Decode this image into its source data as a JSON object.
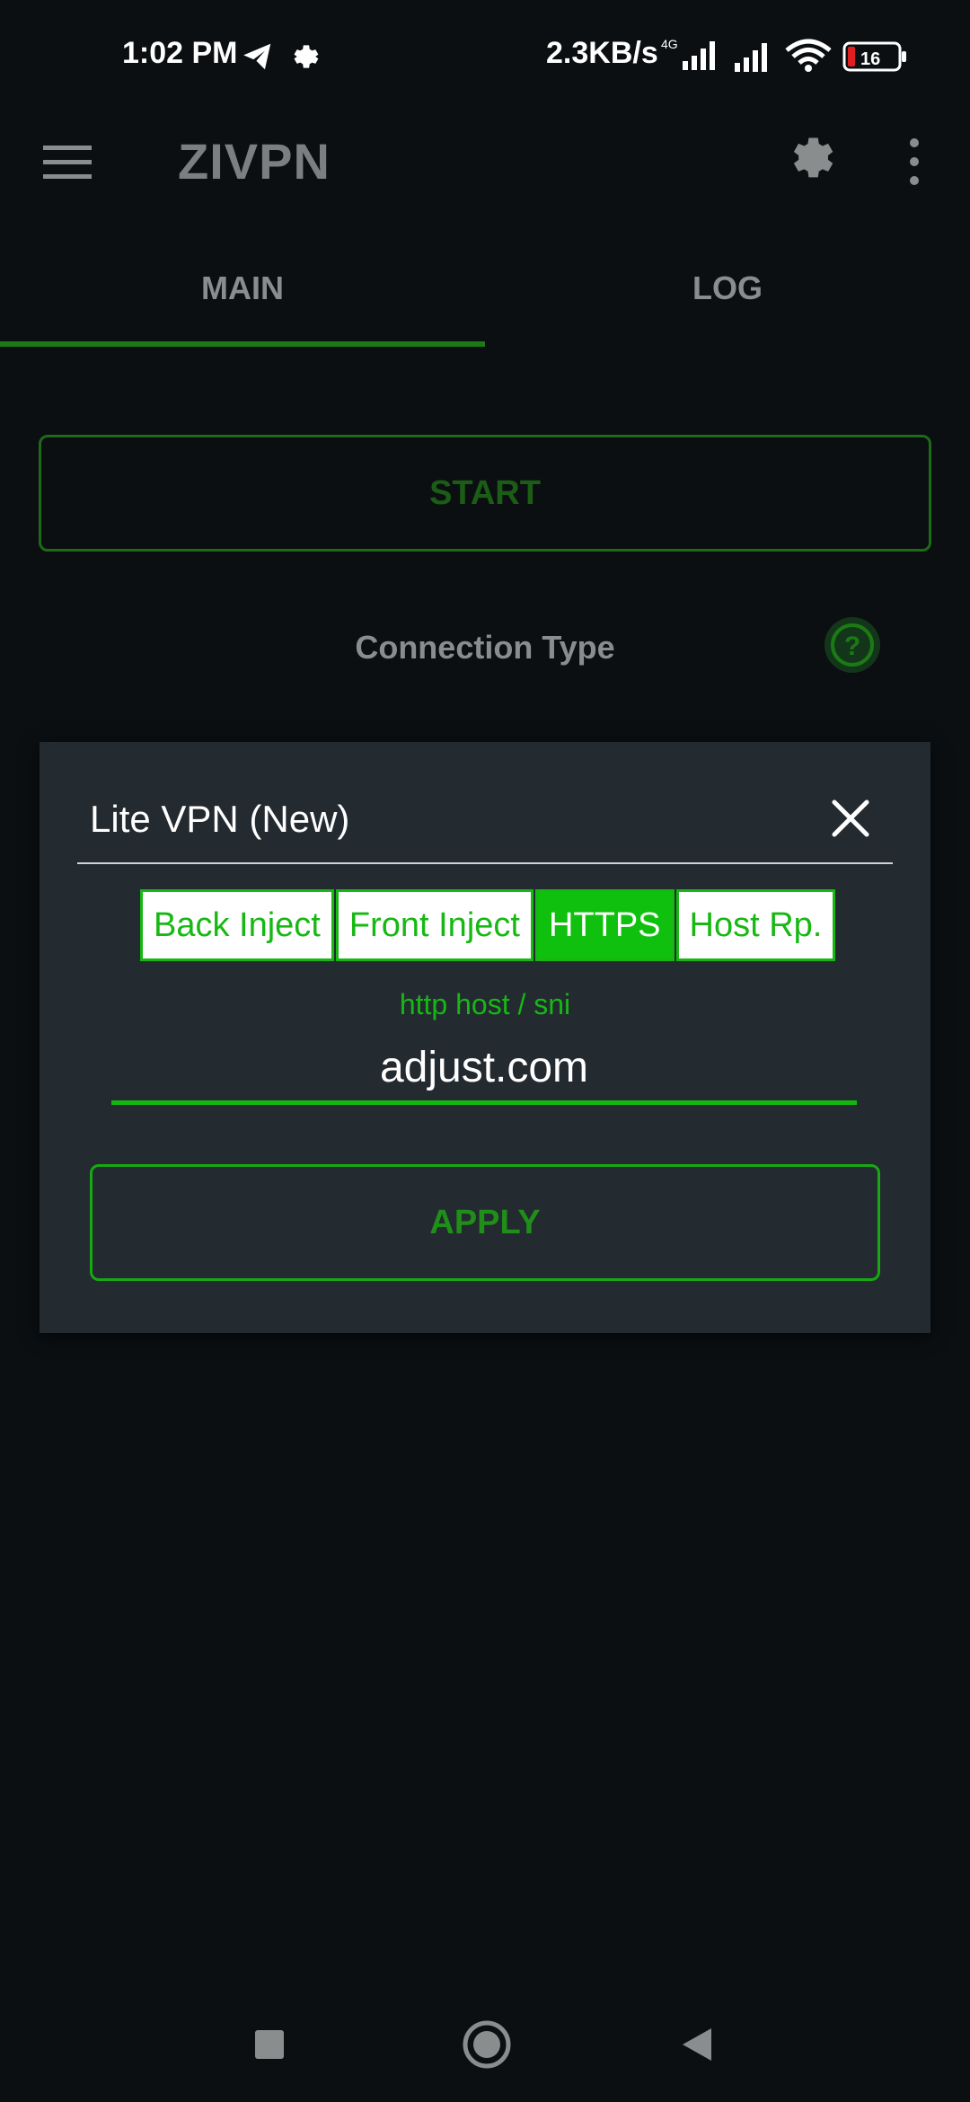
{
  "status": {
    "time": "1:02 PM",
    "speed": "2.3KB/s",
    "network": "4G",
    "battery": "16"
  },
  "app": {
    "title": "ZIVPN"
  },
  "tabs": [
    {
      "label": "MAIN",
      "active": true
    },
    {
      "label": "LOG",
      "active": false
    }
  ],
  "main": {
    "start_label": "START",
    "connection_type_label": "Connection Type"
  },
  "dialog": {
    "title": "Lite VPN (New)",
    "segments": [
      {
        "label": "Back Inject",
        "active": false
      },
      {
        "label": "Front Inject",
        "active": false
      },
      {
        "label": "HTTPS",
        "active": true
      },
      {
        "label": "Host Rp.",
        "active": false
      }
    ],
    "field_label": "http host / sni",
    "field_value": "adjust.com",
    "apply_label": "APPLY"
  },
  "colors": {
    "accent": "#10c00e",
    "background": "#0b0f12",
    "dialog_bg": "#232a30"
  }
}
